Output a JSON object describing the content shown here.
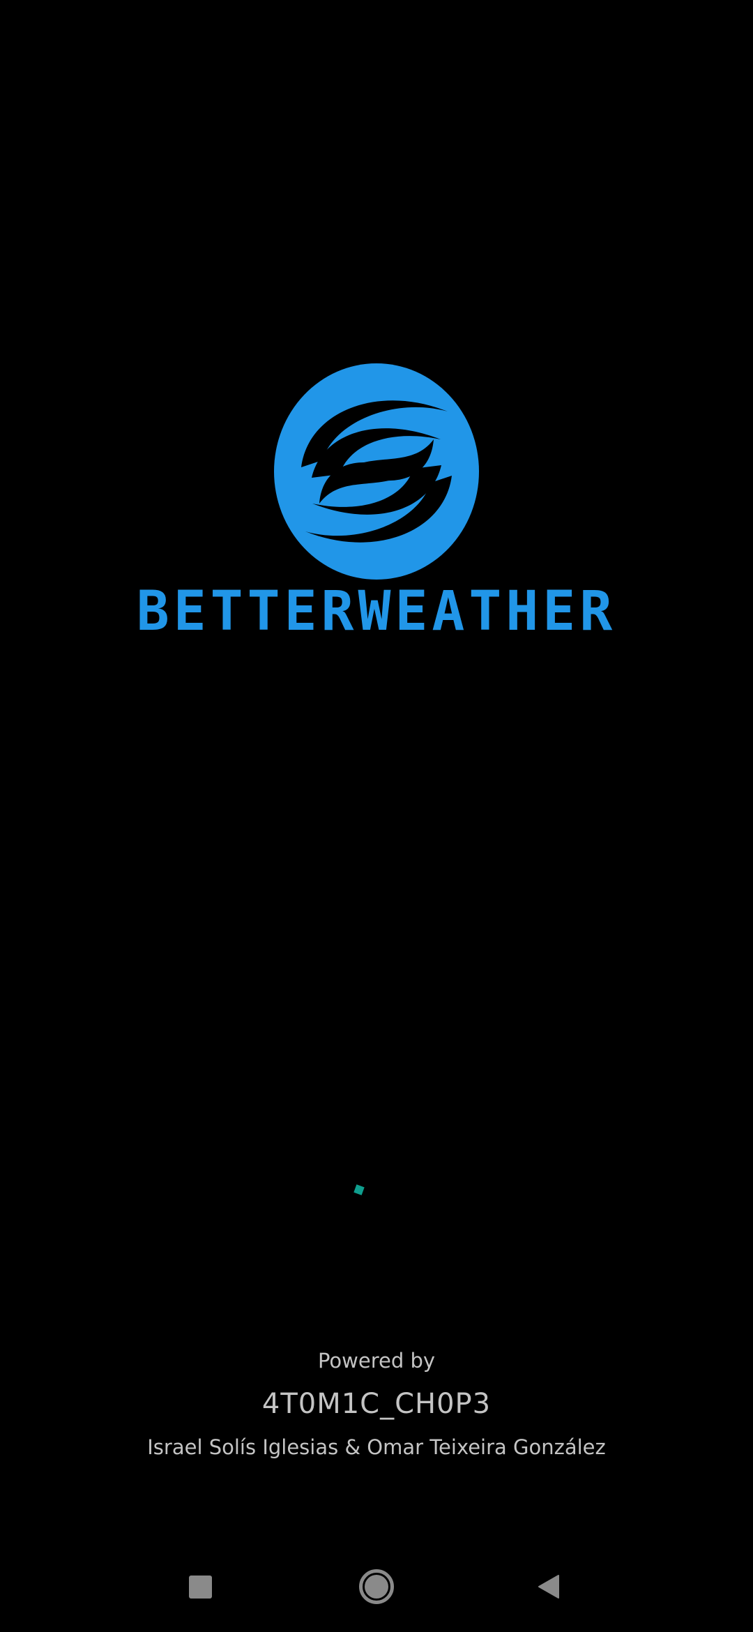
{
  "app": {
    "logo_text": "BETTERWEATHER",
    "logo_icon": "swirl-weather-logo-icon",
    "brand_color": "#2196e8"
  },
  "loading": {
    "spinner_color": "#0f9e8e"
  },
  "credits": {
    "powered_by": "Powered by",
    "team": "4T0M1C_CH0P3",
    "authors": "Israel Solís Iglesias & Omar Teixeira González"
  },
  "navbar": {
    "recents_icon": "square-icon",
    "home_icon": "circle-home-icon",
    "back_icon": "triangle-back-icon"
  }
}
